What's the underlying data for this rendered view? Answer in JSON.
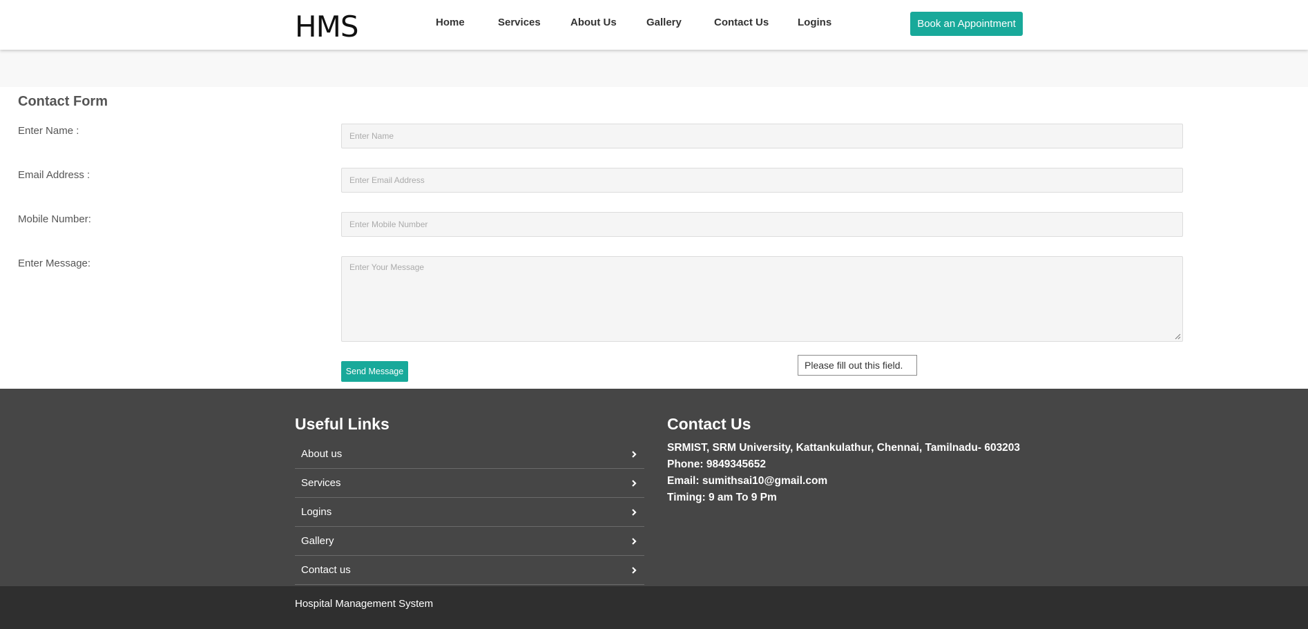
{
  "header": {
    "logo": "HMS",
    "nav": [
      {
        "label": "Home"
      },
      {
        "label": "Services"
      },
      {
        "label": "About Us"
      },
      {
        "label": "Gallery"
      },
      {
        "label": "Contact Us"
      },
      {
        "label": "Logins"
      }
    ],
    "appointment_button": "Book an Appointment"
  },
  "form": {
    "title": "Contact Form",
    "fields": {
      "name": {
        "label": "Enter Name :",
        "placeholder": "Enter Name",
        "value": ""
      },
      "email": {
        "label": "Email Address :",
        "placeholder": "Enter Email Address",
        "value": ""
      },
      "mobile": {
        "label": "Mobile Number:",
        "placeholder": "Enter Mobile Number",
        "value": ""
      },
      "message": {
        "label": "Enter Message:",
        "placeholder": "Enter Your Message",
        "value": ""
      }
    },
    "submit_label": "Send Message",
    "validation_tooltip": "Please fill out this field."
  },
  "footer": {
    "links_heading": "Useful Links",
    "links": [
      {
        "label": "About us",
        "icon": "chevron-right-icon"
      },
      {
        "label": "Services",
        "icon": "chevron-right-icon"
      },
      {
        "label": "Logins",
        "icon": "chevron-right-icon"
      },
      {
        "label": "Gallery",
        "icon": "chevron-right-icon"
      },
      {
        "label": "Contact us",
        "icon": "chevron-right-icon"
      }
    ],
    "contact_heading": "Contact Us",
    "address": "SRMIST, SRM University, Kattankulathur, Chennai, Tamilnadu- 603203",
    "phone": "Phone: 9849345652",
    "email": "Email: sumithsai10@gmail.com",
    "timing": "Timing: 9 am To 9 Pm",
    "copyright": "Hospital Management System"
  },
  "colors": {
    "accent": "#18a99a",
    "footer_bg": "#464646",
    "bottom_bar_bg": "#2f2f2f"
  }
}
